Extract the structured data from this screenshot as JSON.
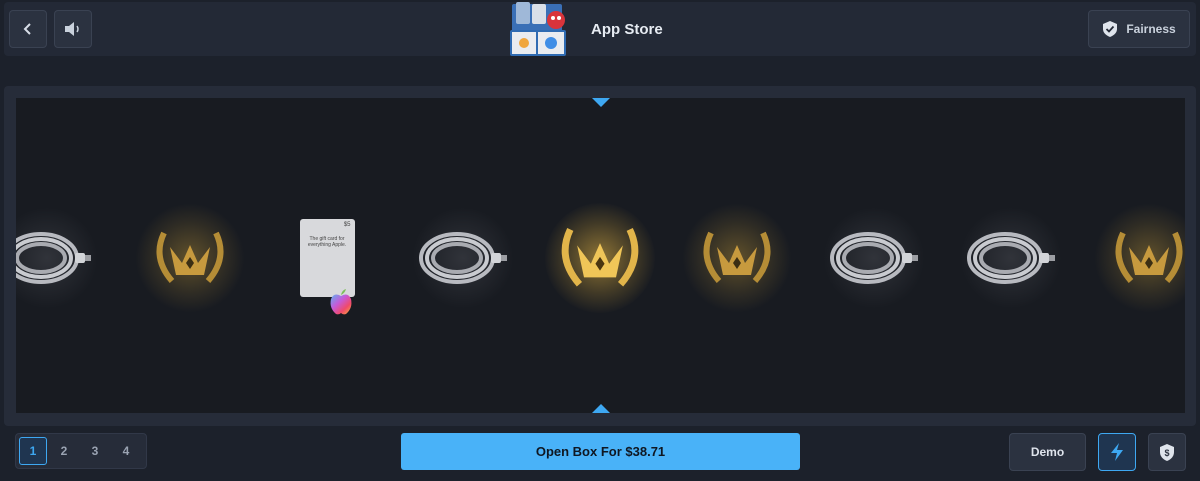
{
  "header": {
    "title": "App Store",
    "back_icon": "chevron-left-icon",
    "sound_icon": "speaker-icon",
    "fairness_label": "Fairness",
    "fairness_icon": "shield-check-icon"
  },
  "reel": {
    "items": [
      {
        "type": "cable",
        "icon": "usb-cable-icon"
      },
      {
        "type": "crown",
        "icon": "laurel-crown-icon"
      },
      {
        "type": "gift-card",
        "icon": "apple-gift-card-icon",
        "price": "$5",
        "text": "The gift card for everything Apple."
      },
      {
        "type": "cable",
        "icon": "usb-cable-icon"
      },
      {
        "type": "crown",
        "icon": "laurel-crown-icon",
        "highlight": true
      },
      {
        "type": "crown",
        "icon": "laurel-crown-icon"
      },
      {
        "type": "cable",
        "icon": "usb-cable-icon"
      },
      {
        "type": "cable",
        "icon": "usb-cable-icon"
      },
      {
        "type": "crown",
        "icon": "laurel-crown-icon"
      }
    ],
    "marker_color": "#3ea8f2"
  },
  "controls": {
    "pages": [
      "1",
      "2",
      "3",
      "4"
    ],
    "active_page": "1",
    "open_label": "Open Box For $38.71",
    "demo_label": "Demo",
    "fast_icon": "lightning-icon",
    "balance_icon": "shield-dollar-icon",
    "accent": "#49b2f8"
  }
}
